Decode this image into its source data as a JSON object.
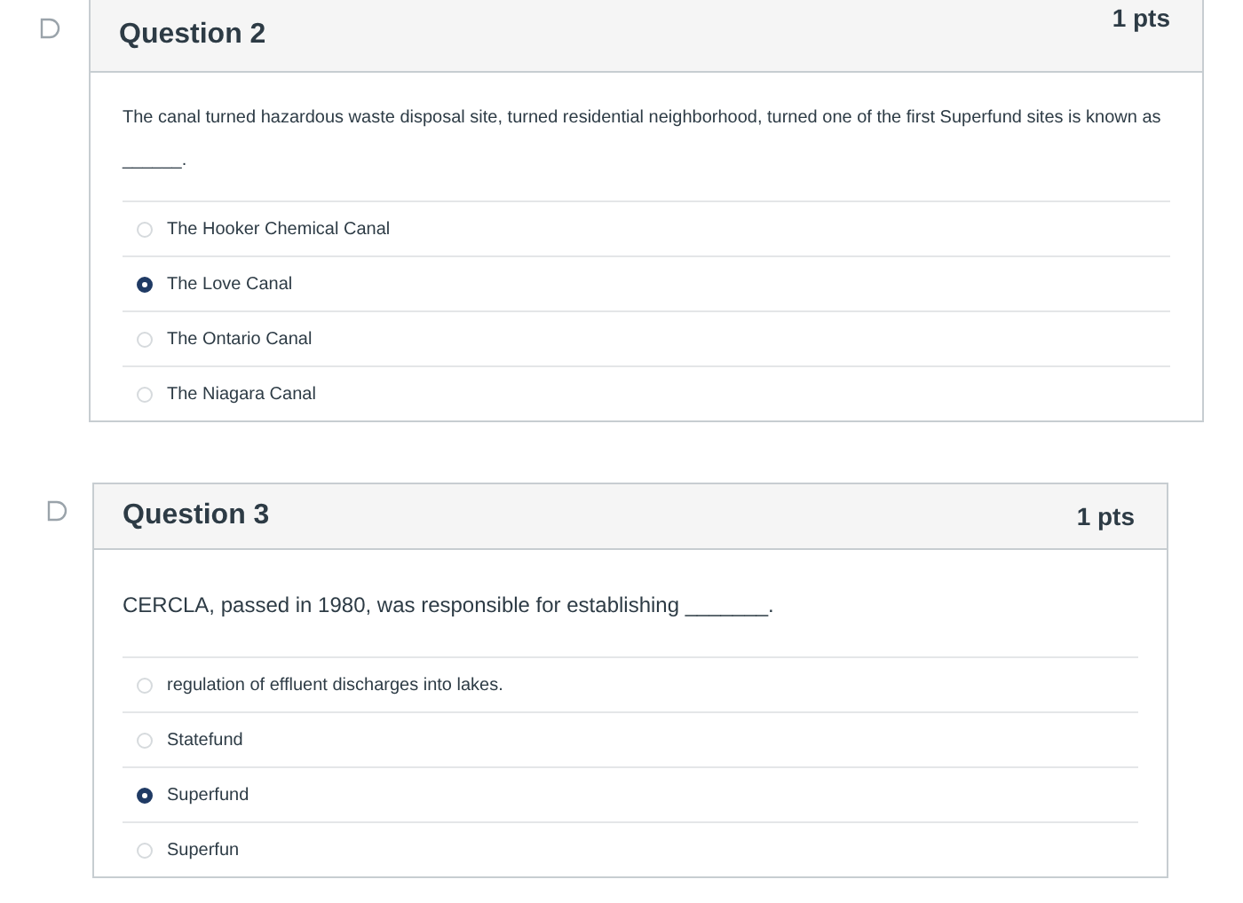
{
  "questions": [
    {
      "title": "Question 2",
      "points": "1 pts",
      "text": "The canal turned hazardous waste disposal site, turned residential neighborhood, turned one of the first Superfund sites is known as ______.",
      "options": [
        {
          "label": "The Hooker Chemical Canal",
          "selected": false
        },
        {
          "label": "The Love Canal",
          "selected": true
        },
        {
          "label": "The Ontario Canal",
          "selected": false
        },
        {
          "label": "The Niagara Canal",
          "selected": false
        }
      ]
    },
    {
      "title": "Question 3",
      "points": "1 pts",
      "text": "CERCLA, passed in 1980, was responsible for establishing _______.",
      "options": [
        {
          "label": "regulation of effluent discharges into lakes.",
          "selected": false
        },
        {
          "label": "Statefund",
          "selected": false
        },
        {
          "label": "Superfund",
          "selected": true
        },
        {
          "label": "Superfun",
          "selected": false
        }
      ]
    }
  ]
}
